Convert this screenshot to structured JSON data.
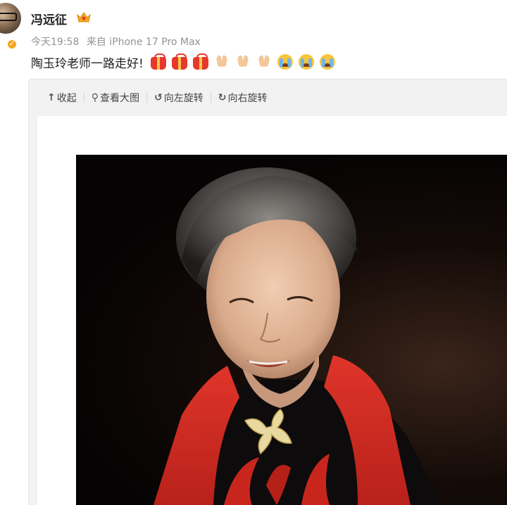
{
  "post": {
    "username": "冯远征",
    "time": "今天19:58",
    "source": "来自 iPhone 17 Pro Max",
    "text": "陶玉玲老师一路走好!",
    "emojis": [
      "gift-icon",
      "gift-icon",
      "gift-icon",
      "pray-icon",
      "pray-icon",
      "pray-icon",
      "cry-icon",
      "cry-icon",
      "cry-icon"
    ]
  },
  "toolbar": {
    "collapse_label": "收起",
    "view_large_label": "查看大图",
    "rotate_left_label": "向左旋转",
    "rotate_right_label": "向右旋转"
  },
  "colors": {
    "accent_red": "#e8372d",
    "muted_text": "#939393",
    "verified_badge": "#f5a623"
  }
}
